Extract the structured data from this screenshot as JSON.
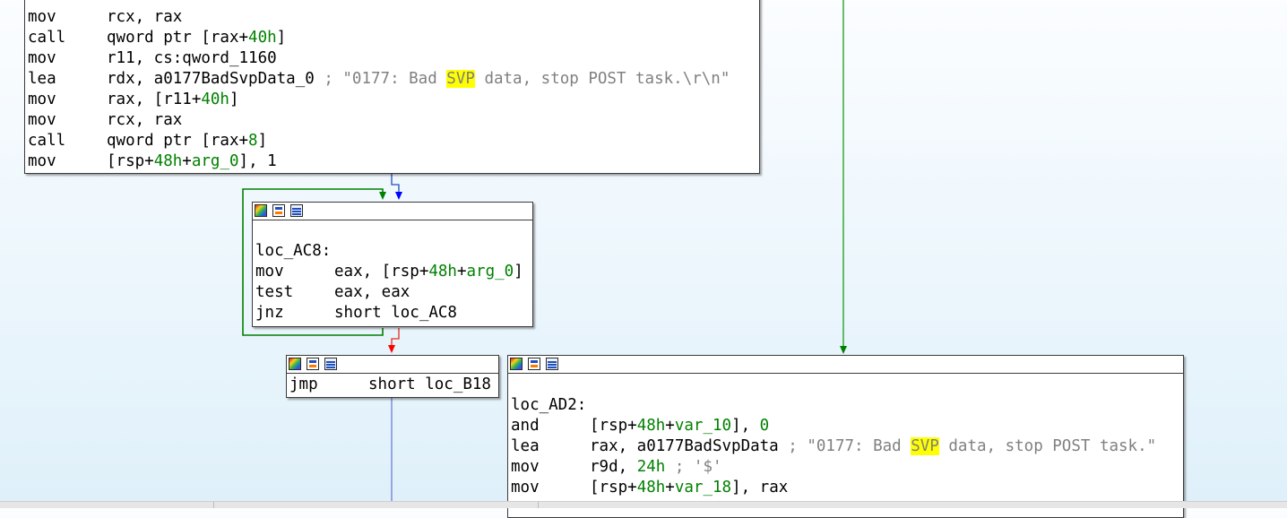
{
  "colors": {
    "accent": "#008000",
    "highlight": "#ffff00",
    "edge_true": "#008000",
    "edge_false": "#ff0000",
    "edge_uncond": "#0000ff"
  },
  "header_icons": [
    "color-palette-icon",
    "graph-view-icon",
    "text-view-icon"
  ],
  "block1": {
    "lines": [
      {
        "mnem": "mov",
        "ops": "rcx, rax"
      },
      {
        "mnem": "call",
        "ops": "qword ptr [rax+",
        "n1": "40h",
        "o2": "]"
      },
      {
        "mnem": "mov",
        "ops": "r11, cs:qword_1160"
      },
      {
        "mnem": "lea",
        "ops": "rdx, a0177BadSvpData_0 ",
        "cmt1": "; \"0177: Bad ",
        "hl": "SVP",
        "cmt2": " data, stop POST task.\\r\\n\""
      },
      {
        "mnem": "mov",
        "ops": "rax, [r11+",
        "n1": "40h",
        "o2": "]"
      },
      {
        "mnem": "mov",
        "ops": "rcx, rax"
      },
      {
        "mnem": "call",
        "ops": "qword ptr [rax+",
        "n1": "8",
        "o2": "]"
      },
      {
        "mnem": "mov",
        "ops": "[rsp+",
        "n1": "48h",
        "o2": "+",
        "n2": "arg_0",
        "o3": "], 1"
      }
    ]
  },
  "block2": {
    "label": "loc_AC8:",
    "lines": [
      {
        "mnem": "mov",
        "ops": "eax, [rsp+",
        "n1": "48h",
        "o2": "+",
        "n2": "arg_0",
        "o3": "]"
      },
      {
        "mnem": "test",
        "ops": "eax, eax"
      },
      {
        "mnem": "jnz",
        "ops": "short loc_AC8"
      }
    ]
  },
  "block3": {
    "lines": [
      {
        "mnem": "jmp",
        "ops": "short loc_B18"
      }
    ]
  },
  "block4": {
    "label": "loc_AD2:",
    "lines": [
      {
        "mnem": "and",
        "ops": "[rsp+",
        "n1": "48h",
        "o2": "+",
        "n2": "var_10",
        "o3": "], ",
        "n3": "0"
      },
      {
        "mnem": "lea",
        "ops": "rax, a0177BadSvpData ",
        "cmt1": "; \"0177: Bad ",
        "hl": "SVP",
        "cmt2": " data, stop POST task.\""
      },
      {
        "mnem": "mov",
        "ops": "r9d, ",
        "n1": "24h",
        "cmt1": " ; '$'"
      },
      {
        "mnem": "mov",
        "ops": "[rsp+",
        "n1": "48h",
        "o2": "+",
        "n2": "var_18",
        "o3": "], rax"
      }
    ]
  }
}
